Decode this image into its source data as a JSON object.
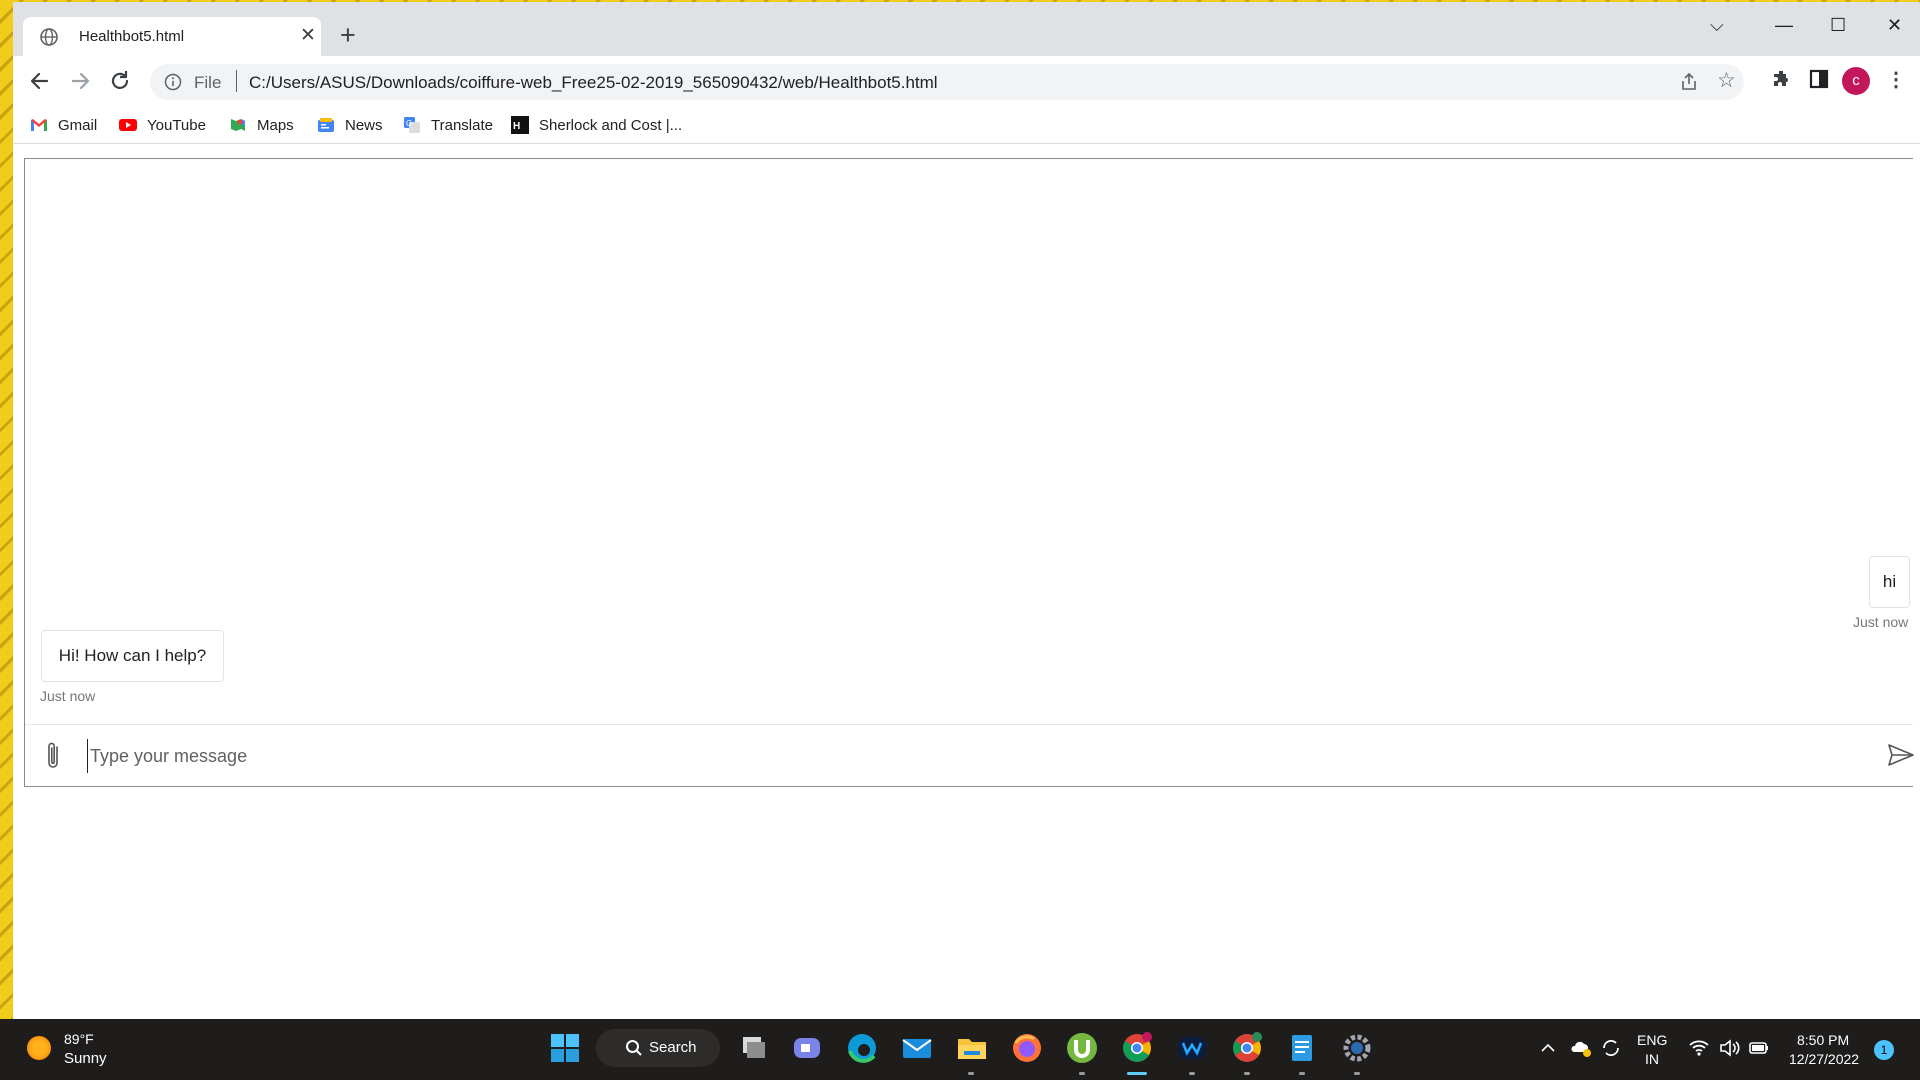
{
  "browser": {
    "tab": {
      "title": "Healthbot5.html",
      "close": "✕"
    },
    "new_tab": "+",
    "window_controls": {
      "tab_search": "⌵",
      "minimize": "—",
      "maximize": "☐",
      "close": "✕"
    },
    "omnibox": {
      "scheme": "File",
      "url": "C:/Users/ASUS/Downloads/coiffure-web_Free25-02-2019_565090432/web/Healthbot5.html"
    },
    "profile_initial": "c",
    "menu": "⋮",
    "bookmarks": [
      {
        "label": "Gmail",
        "icon": "gmail-icon"
      },
      {
        "label": "YouTube",
        "icon": "youtube-icon"
      },
      {
        "label": "Maps",
        "icon": "maps-icon"
      },
      {
        "label": "News",
        "icon": "news-icon"
      },
      {
        "label": "Translate",
        "icon": "translate-icon"
      },
      {
        "label": "Sherlock and Cost |...",
        "icon": "hackerrank-icon"
      }
    ]
  },
  "chat": {
    "messages": [
      {
        "sender": "user",
        "text": "hi",
        "time": "Just now"
      },
      {
        "sender": "bot",
        "text": "Hi! How can I help?",
        "time": "Just now"
      }
    ],
    "input_placeholder": "Type your message",
    "input_value": ""
  },
  "taskbar": {
    "weather": {
      "temp": "89°F",
      "desc": "Sunny"
    },
    "search_label": "Search",
    "pinned": [
      "start-icon",
      "search",
      "task-view-icon",
      "teams-chat-icon",
      "edge-icon",
      "mail-icon",
      "file-explorer-icon",
      "firefox-icon",
      "utorrent-icon",
      "chrome-icon",
      "webex-icon",
      "chrome-profile-icon",
      "notepad-icon",
      "settings-icon"
    ],
    "tray": {
      "lang1": "ENG",
      "lang2": "IN",
      "time": "8:50 PM",
      "date": "12/27/2022",
      "notifications": "1"
    }
  },
  "colors": {
    "profile": "#c2185b",
    "youtube": "#ff0000",
    "accent_bar": "#60cdff",
    "taskbar": "#1f1d1c"
  }
}
